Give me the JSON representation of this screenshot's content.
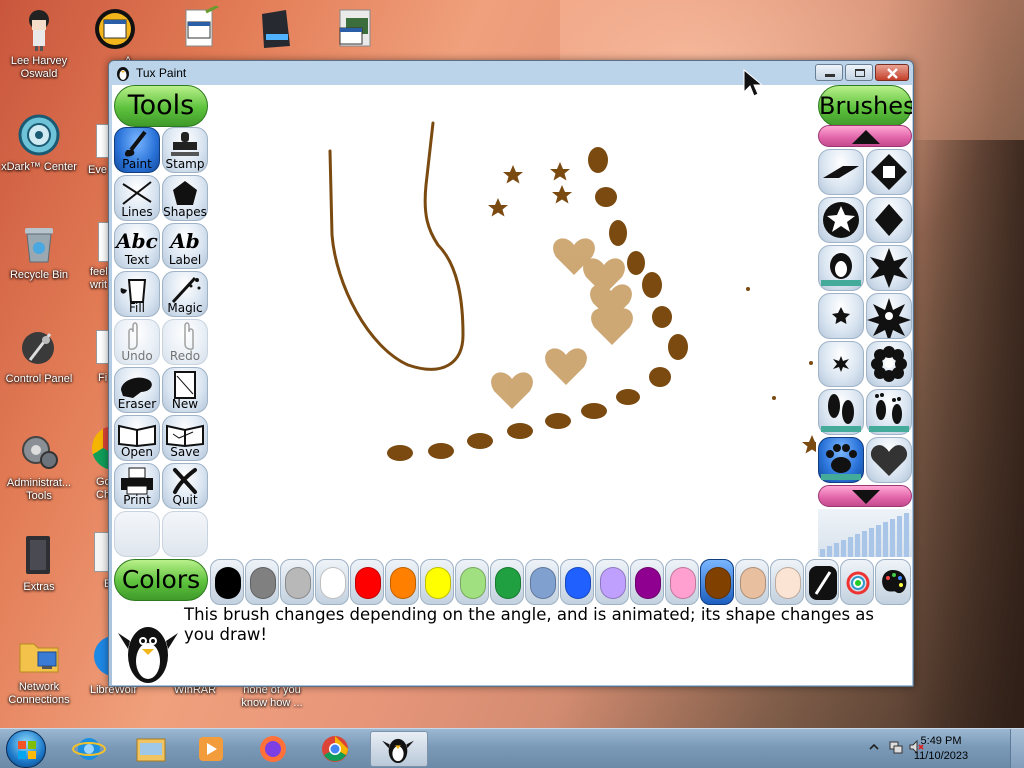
{
  "desktop": {
    "icons": [
      {
        "label": "Lee Harvey Oswald",
        "icon": "anime-character-icon"
      },
      {
        "label": "xDark™ Center",
        "icon": "xdark-center-icon"
      },
      {
        "label": "Recycle Bin",
        "icon": "recycle-bin-icon"
      },
      {
        "label": "Control Panel",
        "icon": "control-panel-icon"
      },
      {
        "label": "Administrat... Tools",
        "icon": "administrative-tools-icon"
      },
      {
        "label": "Extras",
        "icon": "extras-folder-icon"
      },
      {
        "label": "Network Connections",
        "icon": "network-connections-icon"
      },
      {
        "label": "A",
        "icon": "shortcut-icon"
      },
      {
        "label": "Eve",
        "icon": "document-icon"
      },
      {
        "label": "feel writ",
        "icon": "document-icon"
      },
      {
        "label": "Fi",
        "icon": "document-icon"
      },
      {
        "label": "Go Ch",
        "icon": "chrome-icon"
      },
      {
        "label": "E",
        "icon": "document-icon"
      },
      {
        "label": "LibreWolf",
        "icon": "librewolf-icon"
      },
      {
        "label": "WinRAR",
        "icon": "winrar-icon"
      },
      {
        "label": "none of you know how ...",
        "icon": "document-icon"
      }
    ]
  },
  "window": {
    "title": "Tux Paint",
    "controls": [
      "minimize",
      "maximize",
      "close"
    ]
  },
  "tuxpaint": {
    "tools_header": "Tools",
    "brushes_header": "Brushes",
    "colors_header": "Colors",
    "tools": [
      {
        "label": "Paint",
        "icon": "paintbrush-icon",
        "selected": true
      },
      {
        "label": "Stamp",
        "icon": "stamp-icon"
      },
      {
        "label": "Lines",
        "icon": "lines-icon"
      },
      {
        "label": "Shapes",
        "icon": "pentagon-icon"
      },
      {
        "label": "Text",
        "icon": "text-abc-icon"
      },
      {
        "label": "Label",
        "icon": "label-abc-icon"
      },
      {
        "label": "Fill",
        "icon": "paint-bucket-icon"
      },
      {
        "label": "Magic",
        "icon": "magic-wand-icon"
      },
      {
        "label": "Undo",
        "icon": "undo-hand-icon",
        "disabled": true
      },
      {
        "label": "Redo",
        "icon": "redo-hand-icon",
        "disabled": true
      },
      {
        "label": "Eraser",
        "icon": "eraser-icon"
      },
      {
        "label": "New",
        "icon": "new-page-icon"
      },
      {
        "label": "Open",
        "icon": "open-book-icon"
      },
      {
        "label": "Save",
        "icon": "save-book-icon"
      },
      {
        "label": "Print",
        "icon": "printer-icon"
      },
      {
        "label": "Quit",
        "icon": "quit-x-icon"
      }
    ],
    "brushes": [
      "parallelogram-brush-icon",
      "diamond-square-brush-icon",
      "star-circle-brush-icon",
      "diamond-brush-icon",
      "animated-tux-brush-icon",
      "big-star-brush-icon",
      "small-star-brush-icon",
      "eight-point-star-brush-icon",
      "tiny-star-brush-icon",
      "flower-brush-icon",
      "footprints-brush-icon",
      "bare-footprints-brush-icon",
      "paw-print-brush-icon",
      "heart-brush-icon"
    ],
    "selected_brush": "paw-print-brush-icon",
    "colors": [
      {
        "name": "black",
        "hex": "#000000"
      },
      {
        "name": "dark-gray",
        "hex": "#808080"
      },
      {
        "name": "light-gray",
        "hex": "#b8b8b8"
      },
      {
        "name": "white",
        "hex": "#ffffff"
      },
      {
        "name": "red",
        "hex": "#ff0000"
      },
      {
        "name": "orange",
        "hex": "#ff8000"
      },
      {
        "name": "yellow",
        "hex": "#ffff00"
      },
      {
        "name": "light-green",
        "hex": "#a0e080"
      },
      {
        "name": "dark-green",
        "hex": "#20a040"
      },
      {
        "name": "sky-blue",
        "hex": "#80a0d0"
      },
      {
        "name": "blue",
        "hex": "#2060ff"
      },
      {
        "name": "lavender",
        "hex": "#c0a0ff"
      },
      {
        "name": "purple",
        "hex": "#900090"
      },
      {
        "name": "pink",
        "hex": "#ffa0d0"
      },
      {
        "name": "brown",
        "hex": "#804000",
        "selected": true
      },
      {
        "name": "tan",
        "hex": "#e8c0a0"
      },
      {
        "name": "beige",
        "hex": "#fbe4d4"
      }
    ],
    "color_tools": [
      "color-picker-icon",
      "color-wheel-icon",
      "palette-icon"
    ],
    "tip": "This brush changes depending on the angle, and is animated; its shape changes as you draw!",
    "paint_color": "#7a4a10"
  },
  "taskbar": {
    "items": [
      "start-button",
      "internet-explorer-icon",
      "file-explorer-icon",
      "media-player-icon",
      "firefox-icon",
      "chrome-icon",
      "tux-paint-icon"
    ],
    "time": "5:49 PM",
    "date": "11/10/2023"
  }
}
